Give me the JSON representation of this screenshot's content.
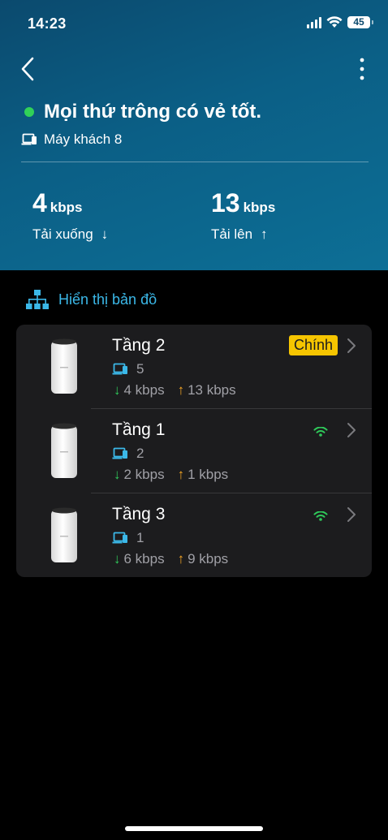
{
  "status_bar": {
    "time": "14:23",
    "battery": "45"
  },
  "header": {
    "status_text": "Mọi thứ trông có vẻ tốt.",
    "clients_label": "Máy khách 8",
    "download": {
      "value": "4",
      "unit": "kbps",
      "label": "Tải xuống",
      "arrow": "↓"
    },
    "upload": {
      "value": "13",
      "unit": "kbps",
      "label": "Tải lên",
      "arrow": "↑"
    }
  },
  "map_link": {
    "label": "Hiển thị bản đồ"
  },
  "devices": [
    {
      "name": "Tầng 2",
      "clients": "5",
      "down": "4 kbps",
      "up": "13 kbps",
      "badge": "Chính"
    },
    {
      "name": "Tầng 1",
      "clients": "2",
      "down": "2 kbps",
      "up": "1 kbps"
    },
    {
      "name": "Tầng 3",
      "clients": "1",
      "down": "6 kbps",
      "up": "9 kbps"
    }
  ],
  "arrows": {
    "down": "↓",
    "up": "↑"
  },
  "colors": {
    "accent": "#3bb8e8",
    "ok": "#31d158",
    "badge": "#f6c500",
    "upload": "#f5a623",
    "header_bg": "#0b5f86"
  }
}
